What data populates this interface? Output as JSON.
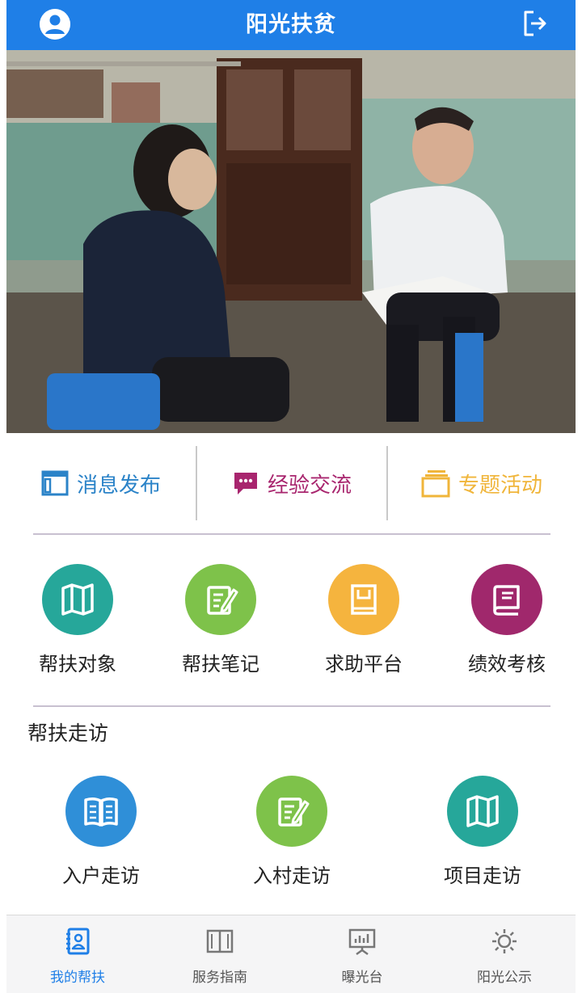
{
  "header": {
    "title": "阳光扶贫",
    "bg_color": "#1f7fe7",
    "left_icon": "user-avatar-icon",
    "right_icon": "logout-icon"
  },
  "hero": {
    "content": "photo"
  },
  "categories": [
    {
      "label": "消息发布",
      "icon": "browser-window-icon",
      "color": "#2b83c8"
    },
    {
      "label": "经验交流",
      "icon": "chat-bubble-icon",
      "color": "#a8256e"
    },
    {
      "label": "专题活动",
      "icon": "stacked-cards-icon",
      "color": "#f0b53a"
    }
  ],
  "grid": [
    {
      "label": "帮扶对象",
      "icon": "map-icon",
      "color": "#26a79a"
    },
    {
      "label": "帮扶笔记",
      "icon": "notepad-pen-icon",
      "color": "#7ec24a"
    },
    {
      "label": "求助平台",
      "icon": "book-cover-icon",
      "color": "#f5b43e"
    },
    {
      "label": "绩效考核",
      "icon": "closed-book-icon",
      "color": "#a0286c"
    }
  ],
  "visits": {
    "title": "帮扶走访",
    "items": [
      {
        "label": "入户走访",
        "icon": "open-book-icon",
        "color": "#2f8fd8"
      },
      {
        "label": "入村走访",
        "icon": "notepad-pen-icon",
        "color": "#7ec24a"
      },
      {
        "label": "项目走访",
        "icon": "map-icon",
        "color": "#26a79a"
      }
    ]
  },
  "tabbar": {
    "items": [
      {
        "label": "我的帮扶",
        "icon": "contact-card-icon",
        "active": true
      },
      {
        "label": "服务指南",
        "icon": "open-book-outline-icon",
        "active": false
      },
      {
        "label": "曝光台",
        "icon": "presentation-board-icon",
        "active": false
      },
      {
        "label": "阳光公示",
        "icon": "sun-icon",
        "active": false
      }
    ],
    "active_color": "#1f7fe7"
  }
}
